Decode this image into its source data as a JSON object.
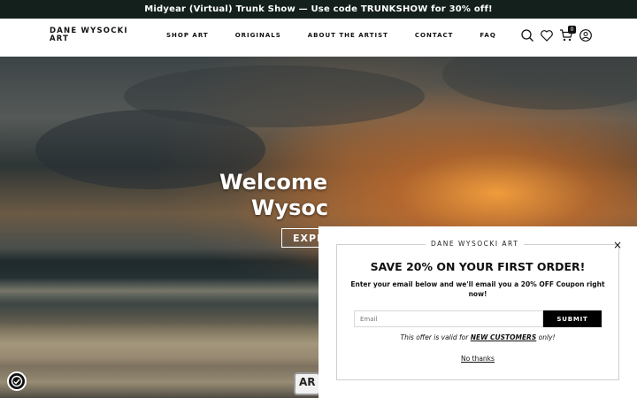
{
  "announcement": "Midyear (Virtual) Trunk Show — Use code TRUNKSHOW for 30% off!",
  "header": {
    "logo": "DANE WYSOCKI ART",
    "nav": [
      "SHOP ART",
      "ORIGINALS",
      "ABOUT THE ARTIST",
      "CONTACT",
      "FAQ"
    ],
    "icons": [
      "search-icon",
      "heart-icon",
      "cart-icon",
      "account-icon"
    ],
    "cart_count": "0"
  },
  "hero": {
    "title": "Welcome to Dane Wysocki Art",
    "visible_title_line1": "Welcome",
    "visible_title_line2": "Wysoc",
    "button": "EXPL",
    "badge": "AR"
  },
  "popup": {
    "brand": "DANE WYSOCKI ART",
    "title": "SAVE 20% ON YOUR FIRST ORDER!",
    "text": "Enter your email below and we'll email you a 20% OFF Coupon right now!",
    "email_placeholder": "Email",
    "submit": "SUBMIT",
    "note_prefix": "This offer is valid for",
    "note_highlight": "NEW CUSTOMERS",
    "note_suffix": "only!",
    "no_thanks": "No thanks",
    "close": "×"
  },
  "colors": {
    "announcement_bg": "#14201b",
    "submit_bg": "#000000"
  }
}
